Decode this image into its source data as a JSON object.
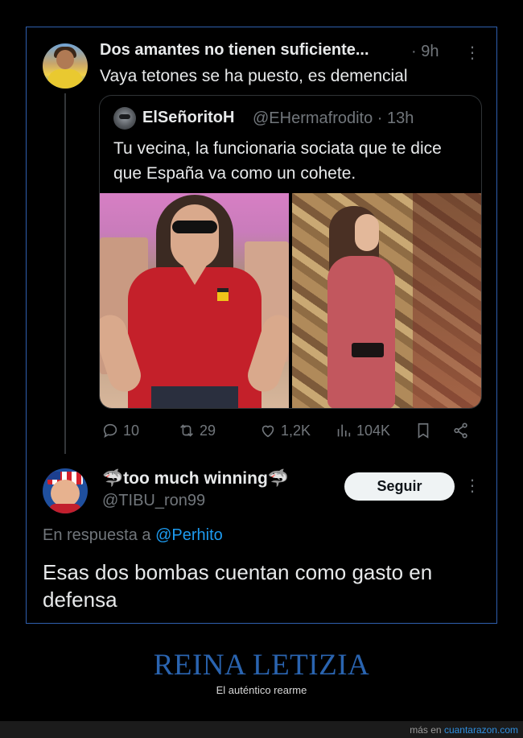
{
  "tweet": {
    "author": "Dos amantes no tienen suficiente...",
    "time": "· 9h",
    "text": "Vaya tetones se ha puesto, es demencial",
    "more_icon": "⋮"
  },
  "quoted_tweet": {
    "name": "ElSeñoritoH",
    "handle_time": "@EHermafrodito · 13h",
    "text": "Tu vecina, la funcionaria sociata que te dice que España va como un cohete."
  },
  "actions": {
    "replies": "10",
    "reposts": "29",
    "likes": "1,2K",
    "views": "104K"
  },
  "reply": {
    "name": "🦈too much winning🦈",
    "handle": "@TIBU_ron99",
    "follow_label": "Seguir",
    "reply_prefix": "En respuesta a",
    "reply_mention": "@Perhito",
    "text": "Esas dos bombas cuentan como gasto en defensa"
  },
  "caption": {
    "title": "REINA LETIZIA",
    "subtitle": "El auténtico rearme"
  },
  "footer": {
    "prefix": "más en",
    "site": "cuantarazon.com"
  },
  "colors": {
    "background": "#000000",
    "frame_border": "#2f5fae",
    "muted_text": "#71767b",
    "link": "#1d9bf0",
    "caption_title": "#2a64b0"
  }
}
